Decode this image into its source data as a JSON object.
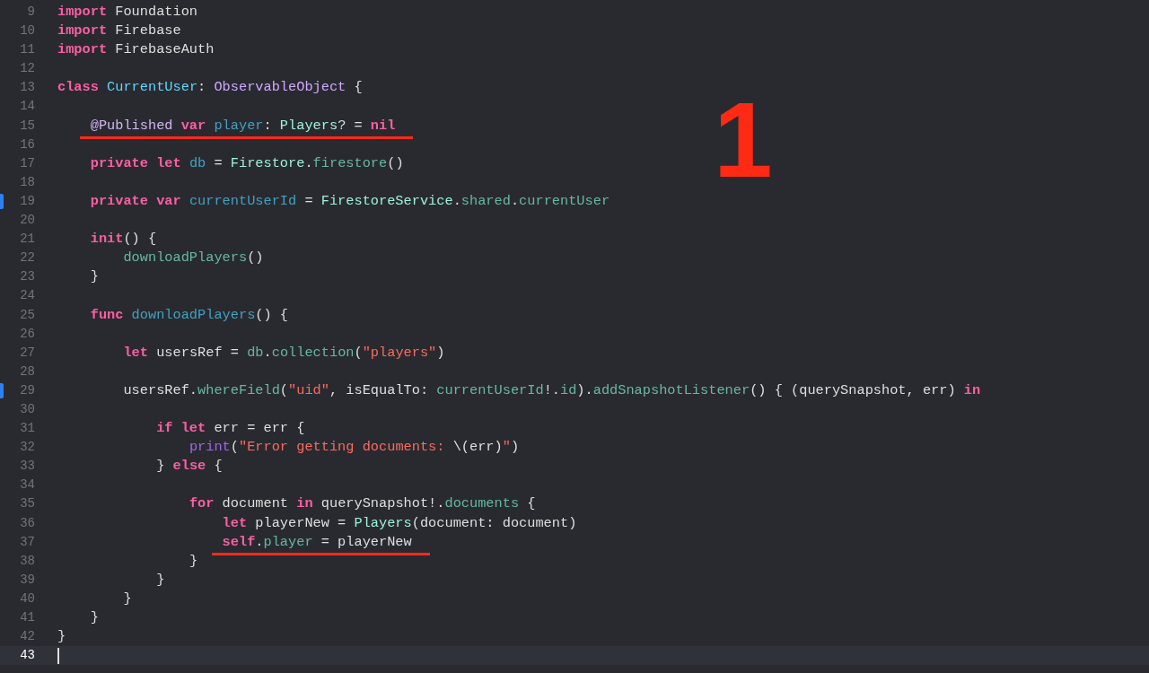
{
  "editor": {
    "annotation_number": "1",
    "lines": [
      {
        "number": "9",
        "current": false,
        "changed": false,
        "underlined": false,
        "tokens": [
          {
            "text": "import",
            "kind": "kw"
          },
          {
            "text": " Foundation",
            "kind": "plain"
          }
        ]
      },
      {
        "number": "10",
        "current": false,
        "changed": false,
        "underlined": false,
        "tokens": [
          {
            "text": "import",
            "kind": "kw"
          },
          {
            "text": " Firebase",
            "kind": "plain"
          }
        ]
      },
      {
        "number": "11",
        "current": false,
        "changed": false,
        "underlined": false,
        "tokens": [
          {
            "text": "import",
            "kind": "kw"
          },
          {
            "text": " FirebaseAuth",
            "kind": "plain"
          }
        ]
      },
      {
        "number": "12",
        "current": false,
        "changed": false,
        "underlined": false
      },
      {
        "number": "13",
        "current": false,
        "changed": false,
        "underlined": false,
        "tokens": [
          {
            "text": "class",
            "kind": "kw"
          },
          {
            "text": " CurrentUser",
            "kind": "type_decl"
          },
          {
            "text": ":",
            "kind": "plain"
          },
          {
            "text": " ObservableObject",
            "kind": "sys_type"
          },
          {
            "text": " {",
            "kind": "plain"
          }
        ]
      },
      {
        "number": "14",
        "current": false,
        "changed": false,
        "underlined": false
      },
      {
        "number": "15",
        "current": false,
        "changed": false,
        "underlined": true,
        "tokens": [
          {
            "text": "@Published",
            "kind": "attr"
          },
          {
            "text": " var",
            "kind": "kw"
          },
          {
            "text": " player",
            "kind": "decl"
          },
          {
            "text": ":",
            "kind": "plain"
          },
          {
            "text": " Players",
            "kind": "proj_type"
          },
          {
            "text": "? =",
            "kind": "plain"
          },
          {
            "text": " nil",
            "kind": "kw"
          }
        ]
      },
      {
        "number": "16",
        "current": false,
        "changed": false,
        "underlined": false
      },
      {
        "number": "17",
        "current": false,
        "changed": false,
        "underlined": false,
        "tokens": [
          {
            "text": "private",
            "kind": "kw"
          },
          {
            "text": " let",
            "kind": "kw"
          },
          {
            "text": " db",
            "kind": "decl"
          },
          {
            "text": " =",
            "kind": "plain"
          },
          {
            "text": " Firestore",
            "kind": "proj_type"
          },
          {
            "text": ".",
            "kind": "plain"
          },
          {
            "text": "firestore",
            "kind": "proj"
          },
          {
            "text": "()",
            "kind": "plain"
          }
        ]
      },
      {
        "number": "18",
        "current": false,
        "changed": false,
        "underlined": false
      },
      {
        "number": "19",
        "current": false,
        "changed": true,
        "underlined": false,
        "tokens": [
          {
            "text": "private",
            "kind": "kw"
          },
          {
            "text": " var",
            "kind": "kw"
          },
          {
            "text": " currentUserId",
            "kind": "decl"
          },
          {
            "text": " =",
            "kind": "plain"
          },
          {
            "text": " FirestoreService",
            "kind": "proj_type"
          },
          {
            "text": ".",
            "kind": "plain"
          },
          {
            "text": "shared",
            "kind": "proj"
          },
          {
            "text": ".",
            "kind": "plain"
          },
          {
            "text": "currentUser",
            "kind": "proj"
          }
        ]
      },
      {
        "number": "20",
        "current": false,
        "changed": false,
        "underlined": false
      },
      {
        "number": "21",
        "current": false,
        "changed": false,
        "underlined": false,
        "tokens": [
          {
            "text": "init",
            "kind": "kw"
          },
          {
            "text": "() {",
            "kind": "plain"
          }
        ]
      },
      {
        "number": "22",
        "current": false,
        "changed": false,
        "underlined": false,
        "tokens": [
          {
            "text": "downloadPlayers",
            "kind": "proj"
          },
          {
            "text": "()",
            "kind": "plain"
          }
        ]
      },
      {
        "number": "23",
        "current": false,
        "changed": false,
        "underlined": false,
        "tokens": [
          {
            "text": "}",
            "kind": "plain"
          }
        ]
      },
      {
        "number": "24",
        "current": false,
        "changed": false,
        "underlined": false
      },
      {
        "number": "25",
        "current": false,
        "changed": false,
        "underlined": false,
        "tokens": [
          {
            "text": "func",
            "kind": "kw"
          },
          {
            "text": " downloadPlayers",
            "kind": "decl"
          },
          {
            "text": "() {",
            "kind": "plain"
          }
        ]
      },
      {
        "number": "26",
        "current": false,
        "changed": false,
        "underlined": false
      },
      {
        "number": "27",
        "current": false,
        "changed": false,
        "underlined": false,
        "tokens": [
          {
            "text": "let",
            "kind": "kw"
          },
          {
            "text": " usersRef =",
            "kind": "plain"
          },
          {
            "text": " db",
            "kind": "proj"
          },
          {
            "text": ".",
            "kind": "plain"
          },
          {
            "text": "collection",
            "kind": "proj"
          },
          {
            "text": "(",
            "kind": "plain"
          },
          {
            "text": "\"players\"",
            "kind": "str"
          },
          {
            "text": ")",
            "kind": "plain"
          }
        ]
      },
      {
        "number": "28",
        "current": false,
        "changed": false,
        "underlined": false
      },
      {
        "number": "29",
        "current": false,
        "changed": true,
        "underlined": false,
        "tokens": [
          {
            "text": "usersRef.",
            "kind": "plain"
          },
          {
            "text": "whereField",
            "kind": "proj"
          },
          {
            "text": "(",
            "kind": "plain"
          },
          {
            "text": "\"uid\"",
            "kind": "str"
          },
          {
            "text": ", isEqualTo:",
            "kind": "plain"
          },
          {
            "text": " currentUserId",
            "kind": "proj"
          },
          {
            "text": "!.",
            "kind": "plain"
          },
          {
            "text": "id",
            "kind": "proj"
          },
          {
            "text": ").",
            "kind": "plain"
          },
          {
            "text": "addSnapshotListener",
            "kind": "proj"
          },
          {
            "text": "() { (querySnapshot, err)",
            "kind": "plain"
          },
          {
            "text": " in",
            "kind": "kw"
          }
        ]
      },
      {
        "number": "30",
        "current": false,
        "changed": false,
        "underlined": false
      },
      {
        "number": "31",
        "current": false,
        "changed": false,
        "underlined": false,
        "tokens": [
          {
            "text": "if",
            "kind": "kw"
          },
          {
            "text": " let",
            "kind": "kw"
          },
          {
            "text": " err = err {",
            "kind": "plain"
          }
        ]
      },
      {
        "number": "32",
        "current": false,
        "changed": false,
        "underlined": false,
        "tokens": [
          {
            "text": "print",
            "kind": "sys_func"
          },
          {
            "text": "(",
            "kind": "plain"
          },
          {
            "text": "\"Error getting documents:",
            "kind": "str"
          },
          {
            "text": " \\(err)",
            "kind": "plain"
          },
          {
            "text": "\"",
            "kind": "str"
          },
          {
            "text": ")",
            "kind": "plain"
          }
        ]
      },
      {
        "number": "33",
        "current": false,
        "changed": false,
        "underlined": false,
        "tokens": [
          {
            "text": "}",
            "kind": "plain"
          },
          {
            "text": " else",
            "kind": "kw"
          },
          {
            "text": " {",
            "kind": "plain"
          }
        ]
      },
      {
        "number": "34",
        "current": false,
        "changed": false,
        "underlined": false
      },
      {
        "number": "35",
        "current": false,
        "changed": false,
        "underlined": false,
        "tokens": [
          {
            "text": "for",
            "kind": "kw"
          },
          {
            "text": " document",
            "kind": "plain"
          },
          {
            "text": " in",
            "kind": "kw"
          },
          {
            "text": " querySnapshot!.",
            "kind": "plain"
          },
          {
            "text": "documents",
            "kind": "proj"
          },
          {
            "text": " {",
            "kind": "plain"
          }
        ]
      },
      {
        "number": "36",
        "current": false,
        "changed": false,
        "underlined": false,
        "tokens": [
          {
            "text": "let",
            "kind": "kw"
          },
          {
            "text": " playerNew =",
            "kind": "plain"
          },
          {
            "text": " Players",
            "kind": "proj_type"
          },
          {
            "text": "(document: document)",
            "kind": "plain"
          }
        ]
      },
      {
        "number": "37",
        "current": false,
        "changed": false,
        "underlined": true,
        "tokens": [
          {
            "text": "self",
            "kind": "kw"
          },
          {
            "text": ".",
            "kind": "plain"
          },
          {
            "text": "player",
            "kind": "proj"
          },
          {
            "text": " = playerNew",
            "kind": "plain"
          }
        ]
      },
      {
        "number": "38",
        "current": false,
        "changed": false,
        "underlined": false,
        "tokens": [
          {
            "text": "}",
            "kind": "plain"
          }
        ]
      },
      {
        "number": "39",
        "current": false,
        "changed": false,
        "underlined": false,
        "tokens": [
          {
            "text": "}",
            "kind": "plain"
          }
        ]
      },
      {
        "number": "40",
        "current": false,
        "changed": false,
        "underlined": false,
        "tokens": [
          {
            "text": "}",
            "kind": "plain"
          }
        ]
      },
      {
        "number": "41",
        "current": false,
        "changed": false,
        "underlined": false,
        "tokens": [
          {
            "text": "}",
            "kind": "plain"
          }
        ]
      },
      {
        "number": "42",
        "current": false,
        "changed": false,
        "underlined": false,
        "tokens": [
          {
            "text": "}",
            "kind": "plain"
          }
        ]
      },
      {
        "number": "43",
        "current": true,
        "changed": false,
        "underlined": false
      }
    ]
  }
}
